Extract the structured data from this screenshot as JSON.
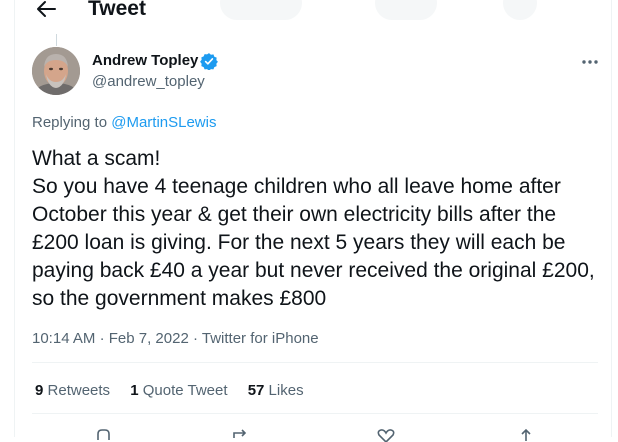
{
  "header": {
    "title": "Tweet"
  },
  "tweet": {
    "author_name": "Andrew Topley",
    "author_handle": "@andrew_topley",
    "reply_prefix": "Replying to",
    "reply_to": "@MartinSLewis",
    "text": "What a scam!\nSo you have 4 teenage children who all leave home after October this year & get their own electricity bills after the £200 loan is giving. For the next 5 years they will each be paying back £40 a year but never received the original £200, so the government makes £800",
    "time": "10:14 AM",
    "date": "Feb 7, 2022",
    "source": "Twitter for iPhone",
    "separator": "·"
  },
  "stats": {
    "retweets_count": "9",
    "retweets_label": "Retweets",
    "quotes_count": "1",
    "quotes_label": "Quote Tweet",
    "likes_count": "57",
    "likes_label": "Likes"
  },
  "icons": {
    "back": "arrow-left-icon",
    "verified": "verified-badge-icon",
    "more": "more-dots-icon",
    "reply": "reply-icon",
    "retweet": "retweet-icon",
    "like": "heart-icon",
    "share": "share-icon"
  },
  "colors": {
    "accent": "#1d9bf0",
    "text": "#0f1419",
    "secondary": "#536471",
    "border": "#eff3f4"
  }
}
